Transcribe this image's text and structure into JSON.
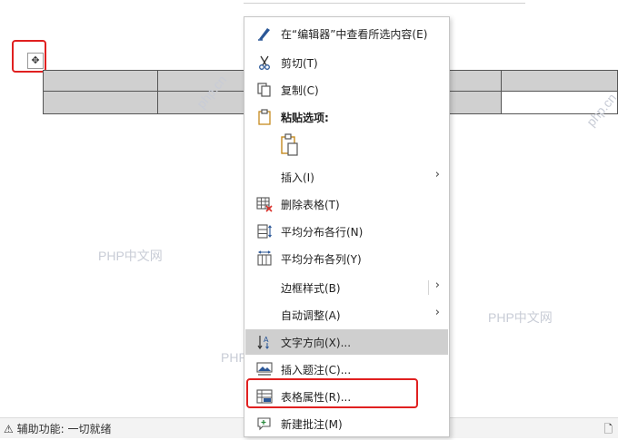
{
  "menu": {
    "items": [
      {
        "label": "在“编辑器”中查看所选内容(E)"
      },
      {
        "label": "剪切(T)"
      },
      {
        "label": "复制(C)"
      },
      {
        "label": "粘贴选项:"
      },
      {
        "label": "插入(I)"
      },
      {
        "label": "删除表格(T)"
      },
      {
        "label": "平均分布各行(N)"
      },
      {
        "label": "平均分布各列(Y)"
      },
      {
        "label": "边框样式(B)"
      },
      {
        "label": "自动调整(A)"
      },
      {
        "label": "文字方向(X)..."
      },
      {
        "label": "插入题注(C)..."
      },
      {
        "label": "表格属性(R)..."
      },
      {
        "label": "新建批注(M)"
      }
    ]
  },
  "watermark": "PHP中文网",
  "watermark_rot": "php.cn",
  "status": {
    "text": "辅助功能: 一切就绪",
    "prefix": "⚠"
  },
  "colors": {
    "highlight_border": "#e02020",
    "hover_bg": "#cfcfcf",
    "selected_cell": "#d0d0d0",
    "accent_icon": "#2b5797"
  }
}
